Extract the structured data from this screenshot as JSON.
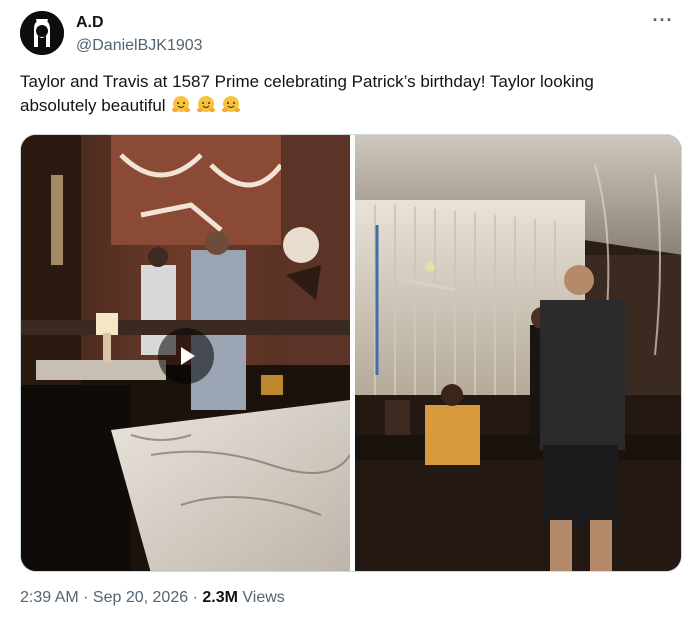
{
  "author": {
    "name": "A.D",
    "handle": "@DanielBJK1903"
  },
  "tweet": {
    "text": "Taylor and Travis at 1587 Prime celebrating Patrick’s birthday! Taylor looking absolutely beautiful",
    "emojis": [
      "hugging-face",
      "hugging-face",
      "hugging-face"
    ]
  },
  "media": {
    "items": [
      {
        "kind": "video",
        "icon": "play-icon"
      },
      {
        "kind": "photo"
      }
    ]
  },
  "meta": {
    "time": "2:39 AM",
    "separator": " · ",
    "date": "Sep 20, 2026",
    "views_count": "2.3M",
    "views_label": "Views"
  },
  "menu": {
    "more_label": "···"
  },
  "colors": {
    "secondary_text": "#536471",
    "primary_text": "#0f1419",
    "border": "#cfd9de"
  }
}
